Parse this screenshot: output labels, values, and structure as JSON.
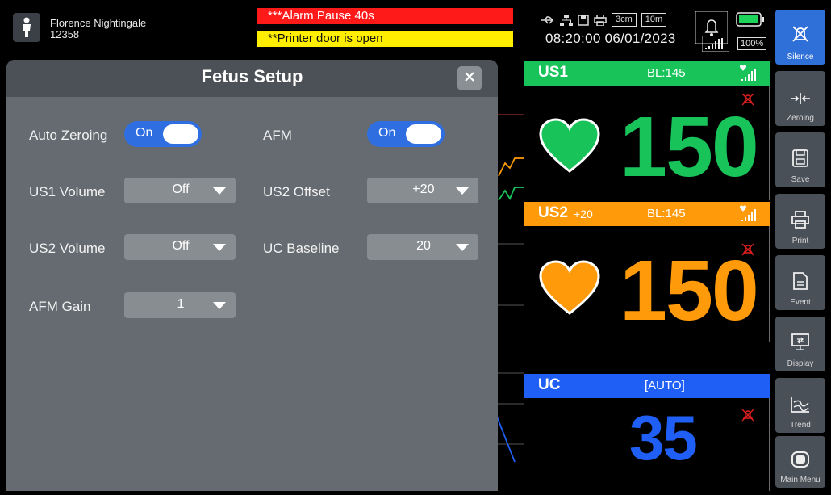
{
  "patient": {
    "name": "Florence Nightingale",
    "id": "12358",
    "icon": "person-icon"
  },
  "alarms": {
    "high": "***Alarm Pause 40s",
    "medium": "**Printer door is open"
  },
  "status": {
    "speed1": "3cm",
    "speed2": "10m",
    "datetime": "08:20:00  06/01/2023",
    "battery": "100%"
  },
  "toolbar": [
    {
      "label": "Silence",
      "icon": "silence-icon",
      "active": true
    },
    {
      "label": "Zeroing",
      "icon": "zeroing-icon"
    },
    {
      "label": "Save",
      "icon": "save-icon"
    },
    {
      "label": "Print",
      "icon": "print-icon"
    },
    {
      "label": "Event",
      "icon": "event-icon"
    },
    {
      "label": "Display",
      "icon": "display-icon"
    },
    {
      "label": "Trend",
      "icon": "trend-icon"
    },
    {
      "label": "Main Menu",
      "icon": "main-menu-icon"
    }
  ],
  "monitors": {
    "us1": {
      "tag": "US1",
      "bl": "BL:145",
      "value": "150",
      "color": "#18c45a"
    },
    "us2": {
      "tag": "US2",
      "offset": "+20",
      "bl": "BL:145",
      "value": "150",
      "color": "#ff9a0a"
    },
    "uc": {
      "tag": "UC",
      "mode": "[AUTO]",
      "value": "35",
      "color": "#1f5ff5"
    }
  },
  "dialog": {
    "title": "Fetus Setup",
    "auto_zeroing": {
      "label": "Auto Zeroing",
      "value": "On"
    },
    "afm": {
      "label": "AFM",
      "value": "On"
    },
    "us1_volume": {
      "label": "US1 Volume",
      "value": "Off"
    },
    "us2_offset": {
      "label": "US2 Offset",
      "value": "+20"
    },
    "us2_volume": {
      "label": "US2 Volume",
      "value": "Off"
    },
    "uc_baseline": {
      "label": "UC Baseline",
      "value": "20"
    },
    "afm_gain": {
      "label": "AFM Gain",
      "value": "1"
    }
  }
}
